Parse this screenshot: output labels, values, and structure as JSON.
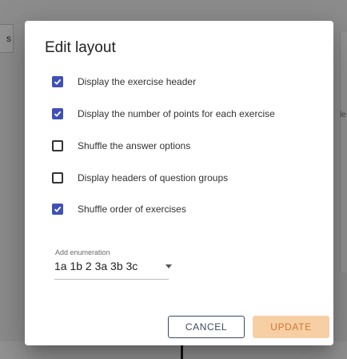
{
  "background": {
    "left_tab_text": "s",
    "right_edge_text": "le"
  },
  "dialog": {
    "title": "Edit layout",
    "options": [
      {
        "label": "Display the exercise header",
        "checked": true
      },
      {
        "label": "Display the number of points for each exercise",
        "checked": true
      },
      {
        "label": "Shuffle the answer options",
        "checked": false
      },
      {
        "label": "Display headers of question groups",
        "checked": false
      },
      {
        "label": "Shuffle order of exercises",
        "checked": true
      }
    ],
    "enumeration": {
      "label": "Add enumeration",
      "value": "1a 1b 2 3a 3b 3c"
    },
    "buttons": {
      "cancel": "CANCEL",
      "update": "UPDATE"
    },
    "colors": {
      "checkbox_accent": "#3f51b5",
      "update_bg": "#f7cfa5",
      "update_text": "#d0782f",
      "cancel_border": "#3b4a63"
    }
  }
}
